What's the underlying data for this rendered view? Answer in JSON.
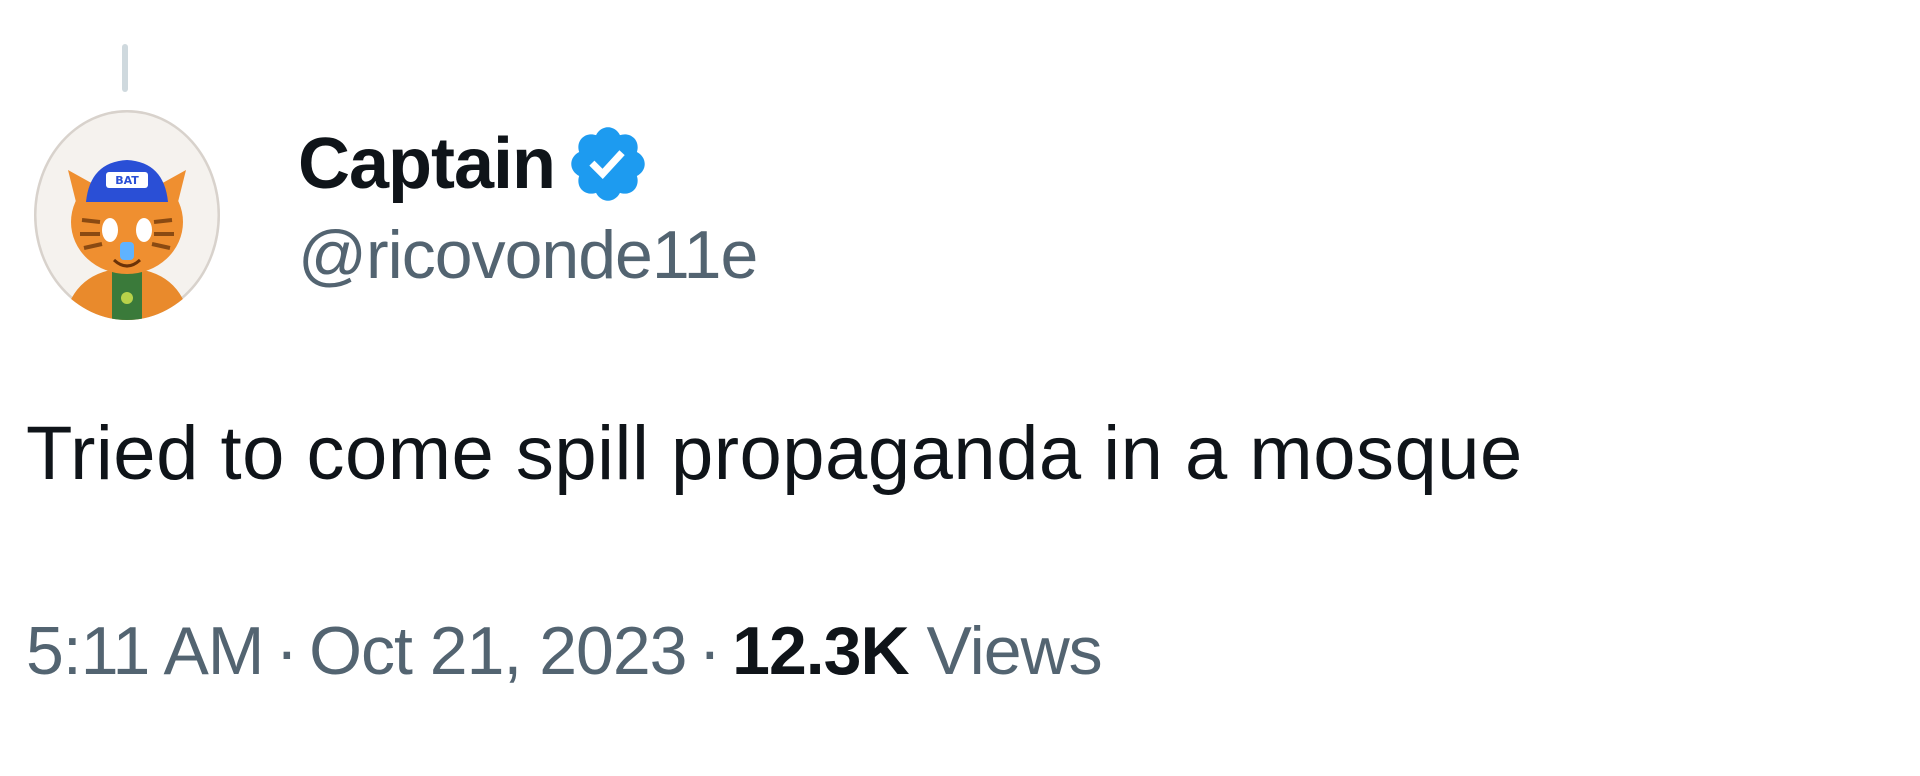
{
  "tweet": {
    "display_name": "Captain",
    "handle": "@ricovonde11e",
    "text": "Tried to come spill propaganda in a mosque",
    "time": "5:11 AM",
    "date": "Oct 21, 2023",
    "separator": "·",
    "views_count": "12.3K",
    "views_label": "Views",
    "verified_icon": "verified-badge-icon",
    "avatar_cap_text": "BAT"
  },
  "colors": {
    "text_primary": "#0f1419",
    "text_secondary": "#536471",
    "verified_blue": "#1d9bf0",
    "thread_line": "#cfd9de"
  }
}
